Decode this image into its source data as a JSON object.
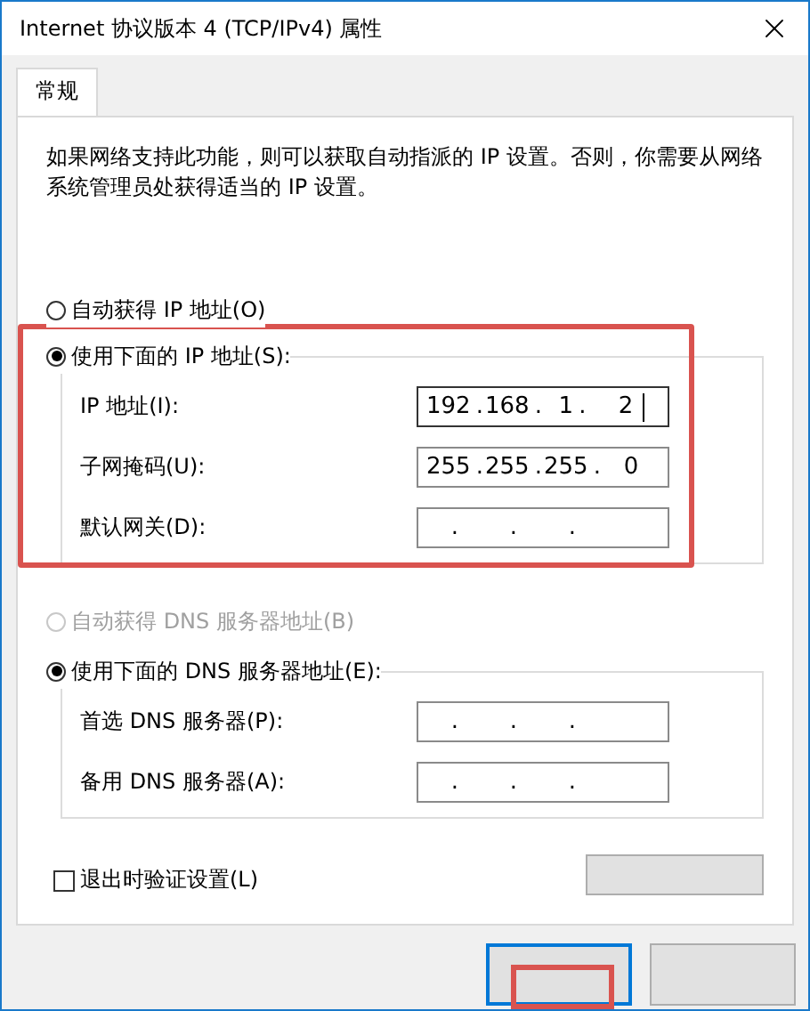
{
  "window": {
    "title": "Internet 协议版本 4 (TCP/IPv4) 属性"
  },
  "tabs": [
    {
      "label": "常规",
      "selected": true
    }
  ],
  "description": "如果网络支持此功能，则可以获取自动指派的 IP 设置。否则，你需要从网络系统管理员处获得适当的 IP 设置。",
  "separator": ".",
  "ip_section": {
    "highlighted": true,
    "options": [
      {
        "label": "自动获得 IP 地址(O)",
        "selected": false,
        "disabled": false
      },
      {
        "label": "使用下面的 IP 地址(S):",
        "selected": true,
        "disabled": false
      }
    ],
    "fields": [
      {
        "label": "IP 地址(I):",
        "octets": [
          "192",
          "168",
          "1",
          "2"
        ],
        "focused": true
      },
      {
        "label": "子网掩码(U):",
        "octets": [
          "255",
          "255",
          "255",
          "0"
        ],
        "focused": false
      },
      {
        "label": "默认网关(D):",
        "focused": false
      }
    ]
  },
  "dns_section": {
    "options": [
      {
        "label": "自动获得 DNS 服务器地址(B)",
        "selected": false,
        "disabled": true
      },
      {
        "label": "使用下面的 DNS 服务器地址(E):",
        "selected": true,
        "disabled": false
      }
    ],
    "fields": [
      {
        "label": "首选 DNS 服务器(P):",
        "focused": false
      },
      {
        "label": "备用 DNS 服务器(A):",
        "focused": false
      }
    ]
  },
  "validate_on_exit": {
    "label": "退出时验证设置(L)",
    "checked": false
  },
  "buttons": [
    {
      "kind": "ok",
      "highlighted": true
    },
    {
      "kind": "cancel"
    }
  ]
}
